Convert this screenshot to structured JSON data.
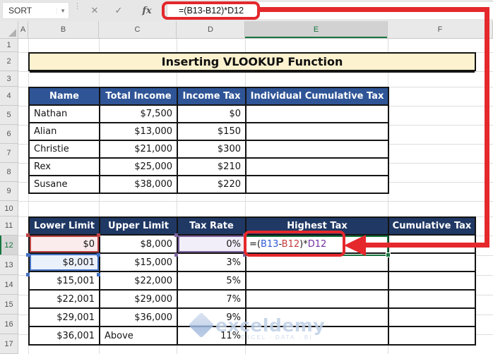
{
  "formula_bar": {
    "name_box": "SORT",
    "formula": "=(B13-B12)*D12",
    "cancel_label": "✕",
    "enter_label": "✓",
    "fx_label": "fx"
  },
  "grid": {
    "column_headers": [
      "A",
      "B",
      "C",
      "D",
      "E",
      "F"
    ],
    "row_numbers": [
      "1",
      "2",
      "3",
      "4",
      "5",
      "6",
      "7",
      "8",
      "9",
      "10",
      "11",
      "12",
      "13",
      "14",
      "15",
      "16",
      "17"
    ],
    "selected_column": "E",
    "selected_row": "12"
  },
  "title_banner": "Inserting VLOOKUP Function",
  "income_table": {
    "headers": [
      "Name",
      "Total Income",
      "Income Tax",
      "Individual Cumulative Tax"
    ],
    "rows": [
      [
        "Nathan",
        "$7,500",
        "$0",
        ""
      ],
      [
        "Alian",
        "$13,000",
        "$150",
        ""
      ],
      [
        "Christie",
        "$21,000",
        "$300",
        ""
      ],
      [
        "Rex",
        "$25,000",
        "$210",
        ""
      ],
      [
        "Susane",
        "$38,000",
        "$220",
        ""
      ]
    ]
  },
  "tax_table": {
    "headers": [
      "Lower Limit",
      "Upper Limit",
      "Tax Rate",
      "Highest Tax",
      "Cumulative Tax"
    ],
    "rows": [
      [
        "$0",
        "$8,000",
        "0%",
        "=(B13-B12)*D12",
        ""
      ],
      [
        "$8,001",
        "$15,000",
        "3%",
        "",
        ""
      ],
      [
        "$15,001",
        "$22,000",
        "5%",
        "",
        ""
      ],
      [
        "$22,001",
        "$29,000",
        "7%",
        "",
        ""
      ],
      [
        "$29,001",
        "$36,000",
        "9%",
        "",
        ""
      ],
      [
        "$36,001",
        "Above",
        "11%",
        "",
        ""
      ]
    ],
    "formula_parts": [
      {
        "text": "=(",
        "color": "#1a1a1a"
      },
      {
        "text": "B13",
        "color": "#2E5BD7"
      },
      {
        "text": "-",
        "color": "#1a1a1a"
      },
      {
        "text": "B12",
        "color": "#C33C3C"
      },
      {
        "text": ")*",
        "color": "#1a1a1a"
      },
      {
        "text": "D12",
        "color": "#7030A0"
      }
    ]
  },
  "watermark": {
    "brand": "exceldemy",
    "tagline": "EXCEL · DATA · BI"
  },
  "colors": {
    "accent_red": "#E4282C",
    "selection_green": "#17753F",
    "banner_bg": "#FCF2CF",
    "table1_header_bg": "#2F5597",
    "table2_header_bg": "#203864",
    "ref_blue": "#4472C4",
    "ref_red": "#BF4545",
    "ref_purple": "#8064A2",
    "watermark_blue": "#BECFE7"
  }
}
